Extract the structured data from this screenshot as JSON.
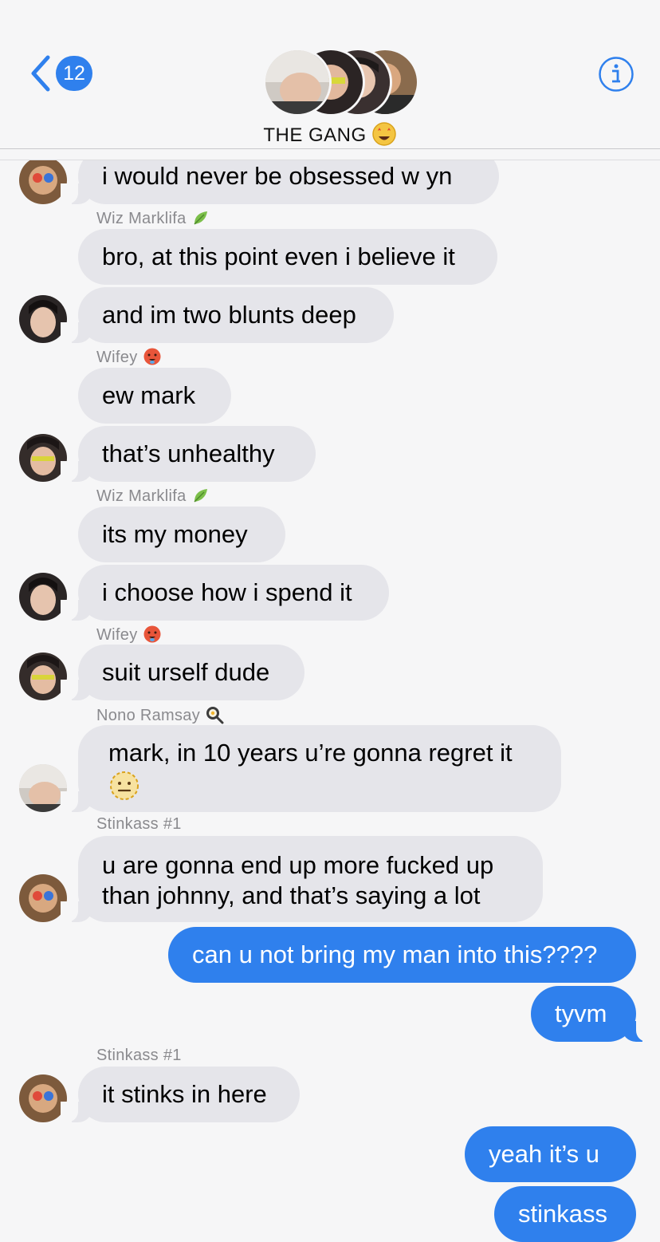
{
  "header": {
    "back_count": "12",
    "title": "THE GANG"
  },
  "messages": {
    "m0": "i would never be obsessed w yn",
    "m1": "bro, at this point even i believe it",
    "m2": "and im two blunts deep",
    "m3": "ew mark",
    "m4": "that’s unhealthy",
    "m5": "its my money",
    "m6": "i choose how i spend it",
    "m7": "suit urself dude",
    "m8": "mark, in 10 years u’re gonna regret it",
    "m9_line1": "u are gonna end up more fucked up",
    "m9_line2": "than johnny, and that’s saying a lot",
    "m10": "can u not bring my man into this????",
    "m11": "tyvm",
    "m12": "it stinks in here",
    "m13": "yeah it’s u",
    "m14": "stinkass"
  },
  "senders": {
    "s1": "Wiz Marklifa",
    "s2": "Wifey",
    "s3": "Wiz Marklifa",
    "s4": "Wifey",
    "s5": "Nono Ramsay",
    "s6": "Stinkass #1",
    "s7": "Stinkass #1"
  },
  "colors": {
    "accent": "#2f80ed",
    "incoming_bubble": "#e5e5ea",
    "background": "#f6f6f7",
    "sender_label": "#8a8a8e"
  },
  "icons": {
    "back": "chevron-left-icon",
    "info": "info-icon",
    "title_emoji": "star-struck-emoji",
    "leaf": "leaf-emoji",
    "hot_face": "hot-face-emoji",
    "pan": "frying-pan-emoji",
    "dotted_face": "dotted-line-face-emoji"
  }
}
